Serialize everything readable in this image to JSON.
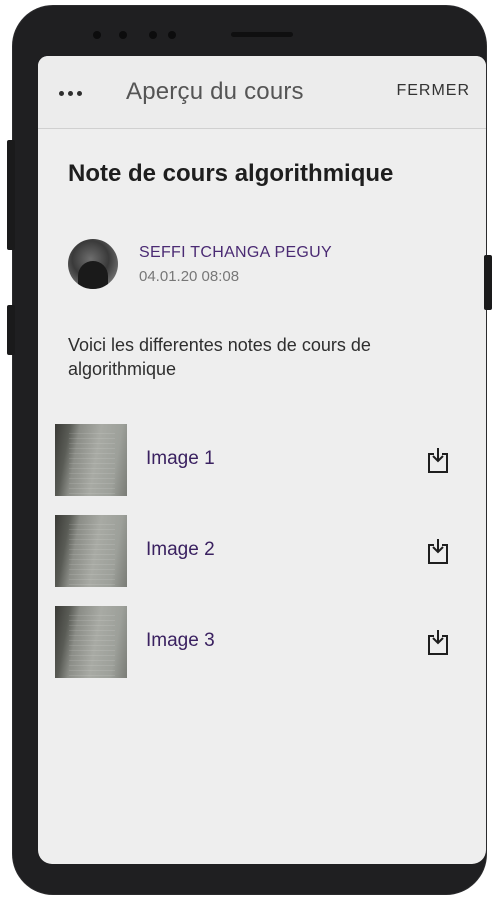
{
  "header": {
    "title": "Aperçu du cours",
    "close_label": "FERMER",
    "menu_icon": "more-horizontal-icon"
  },
  "course": {
    "title": "Note de cours algorithmique",
    "description": "Voici les differentes notes de cours de algorithmique"
  },
  "author": {
    "name": "SEFFI TCHANGA PEGUY",
    "date": "04.01.20 08:08"
  },
  "attachments": [
    {
      "label": "Image 1",
      "icon": "download-icon"
    },
    {
      "label": "Image 2",
      "icon": "download-icon"
    },
    {
      "label": "Image 3",
      "icon": "download-icon"
    }
  ],
  "colors": {
    "accent": "#4a2a73",
    "screen_bg": "#eeeeee",
    "frame": "#1f1f21"
  }
}
